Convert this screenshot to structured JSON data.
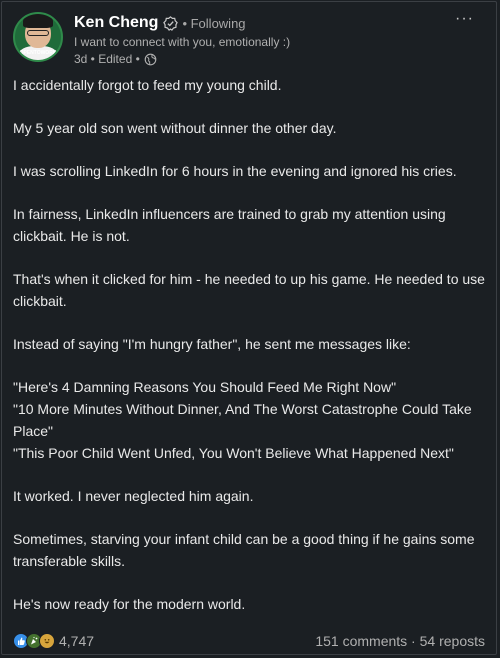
{
  "author": {
    "name": "Ken Cheng",
    "connection": "• Following",
    "headline": "I want to connect with you, emotionally :)",
    "time": "3d • Edited •",
    "avatar_text": "OPENTOWORK"
  },
  "menu": {
    "icon": "···"
  },
  "post": {
    "p1": "I accidentally forgot to feed my young child.",
    "p2": "My 5 year old son went without dinner the other day.",
    "p3": "I was scrolling LinkedIn for 6 hours in the evening and ignored his cries.",
    "p4": "In fairness, LinkedIn influencers are trained to grab my attention using clickbait. He is not.",
    "p5": "That's when it clicked for him - he needed to up his game. He needed to use clickbait.",
    "p6": "Instead of saying \"I'm hungry father\", he sent me messages like:",
    "q1": "\"Here's 4 Damning Reasons You Should Feed Me Right Now\"",
    "q2": "\"10 More Minutes Without Dinner, And The Worst Catastrophe Could Take Place\"",
    "q3": "\"This Poor Child Went Unfed, You Won't Believe What Happened Next\"",
    "p7": "It worked. I never neglected him again.",
    "p8": "Sometimes, starving your infant child can be a good thing if he gains some transferable skills.",
    "p9": "He's now ready for the modern world."
  },
  "social": {
    "reaction_count": "4,747",
    "comments": "151 comments",
    "separator": " · ",
    "reposts": "54 reposts"
  },
  "colors": {
    "background": "#1b1f23",
    "like": "#378fe9",
    "celebrate": "#44712e",
    "funny": "#d8a53c"
  }
}
